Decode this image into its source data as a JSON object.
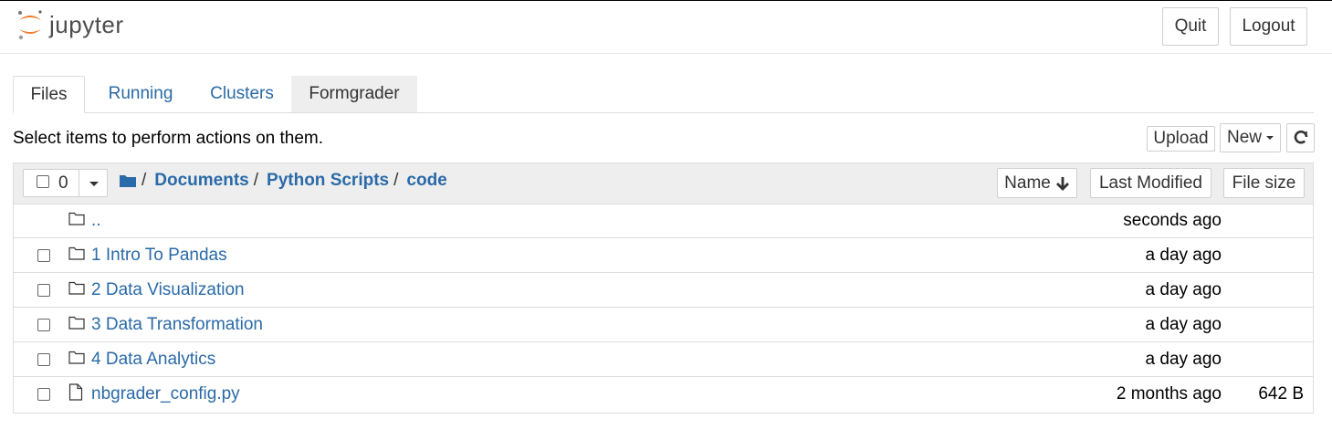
{
  "header": {
    "logo_text": "jupyter",
    "quit_label": "Quit",
    "logout_label": "Logout"
  },
  "tabs": [
    {
      "label": "Files"
    },
    {
      "label": "Running"
    },
    {
      "label": "Clusters"
    },
    {
      "label": "Formgrader"
    }
  ],
  "toolbar": {
    "instruction": "Select items to perform actions on them.",
    "upload_label": "Upload",
    "new_label": "New"
  },
  "list_header": {
    "selected_count": "0",
    "breadcrumb": [
      "Documents",
      "Python Scripts",
      "code"
    ],
    "sort_name_label": "Name",
    "sort_modified_label": "Last Modified",
    "sort_size_label": "File size"
  },
  "rows": [
    {
      "name": "..",
      "modified": "seconds ago",
      "size": "",
      "type": "folder",
      "checkbox": false
    },
    {
      "name": "1 Intro To Pandas",
      "modified": "a day ago",
      "size": "",
      "type": "folder",
      "checkbox": true
    },
    {
      "name": "2 Data Visualization",
      "modified": "a day ago",
      "size": "",
      "type": "folder",
      "checkbox": true
    },
    {
      "name": "3 Data Transformation",
      "modified": "a day ago",
      "size": "",
      "type": "folder",
      "checkbox": true
    },
    {
      "name": "4 Data Analytics",
      "modified": "a day ago",
      "size": "",
      "type": "folder",
      "checkbox": true
    },
    {
      "name": "nbgrader_config.py",
      "modified": "2 months ago",
      "size": "642 B",
      "type": "file",
      "checkbox": true
    }
  ],
  "colors": {
    "link": "#2a6aa8",
    "logo_orange": "#f37726",
    "header_bg": "#eeeeee"
  },
  "icons": {
    "folder": "folder-icon",
    "file": "file-icon",
    "refresh": "refresh-icon",
    "breadcrumb_root": "folder-solid-icon"
  }
}
